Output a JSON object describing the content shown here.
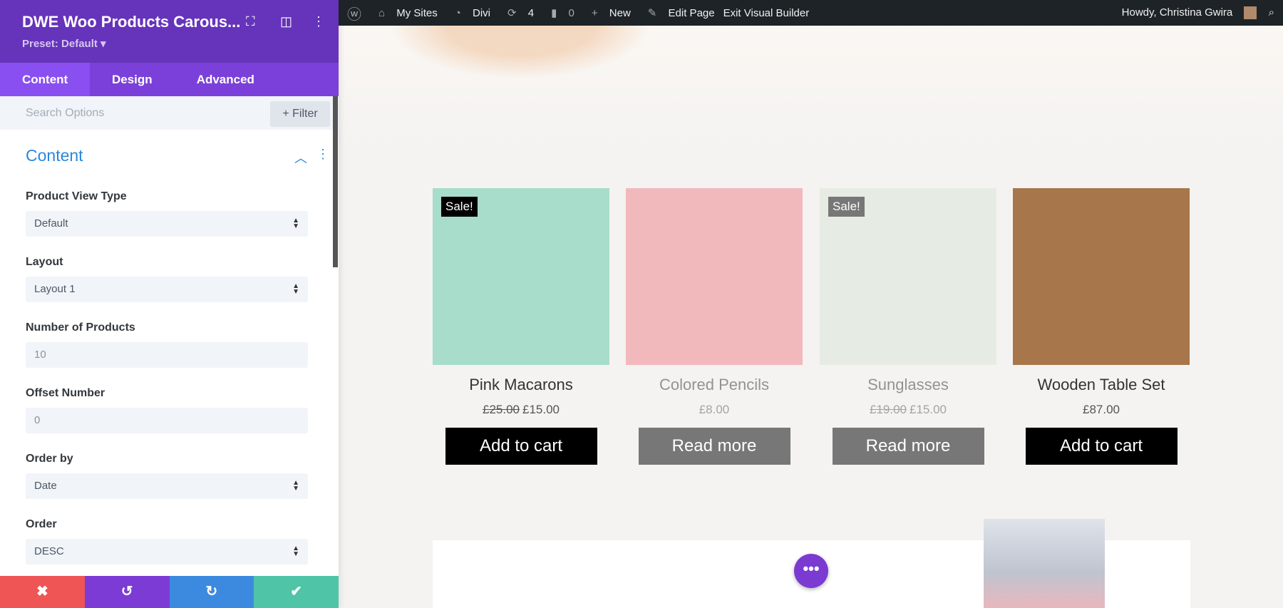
{
  "panel": {
    "title": "DWE Woo Products Carous...",
    "preset": "Preset: Default ▾",
    "tabs": [
      "Content",
      "Design",
      "Advanced"
    ],
    "search_placeholder": "Search Options",
    "filter": "+ Filter",
    "section": "Content",
    "fields": [
      {
        "label": "Product View Type",
        "value": "Default",
        "type": "select"
      },
      {
        "label": "Layout",
        "value": "Layout 1",
        "type": "select"
      },
      {
        "label": "Number of Products",
        "value": "10",
        "type": "input"
      },
      {
        "label": "Offset Number",
        "value": "0",
        "type": "input"
      },
      {
        "label": "Order by",
        "value": "Date",
        "type": "select"
      },
      {
        "label": "Order",
        "value": "DESC",
        "type": "select"
      }
    ],
    "bottom": {
      "close": "✖",
      "undo": "↺",
      "redo": "↻",
      "save": "✔"
    }
  },
  "adminbar": {
    "my_sites": "My Sites",
    "site": "Divi",
    "updates": "4",
    "comments": "0",
    "new": "New",
    "edit": "Edit Page",
    "exit": "Exit Visual Builder",
    "howdy": "Howdy, Christina Gwira"
  },
  "products": [
    {
      "name": "Pink Macarons",
      "old": "£25.00",
      "price": "£15.00",
      "button": "Add to cart",
      "sale": "Sale!",
      "color": "#a8dccb"
    },
    {
      "name": "Colored Pencils",
      "old": "",
      "price": "£8.00",
      "button": "Read more",
      "sale": "",
      "color": "#f2b9bd"
    },
    {
      "name": "Sunglasses",
      "old": "£19.00",
      "price": "£15.00",
      "button": "Read more",
      "sale": "Sale!",
      "color": "#e6ece4"
    },
    {
      "name": "Wooden Table Set",
      "old": "",
      "price": "£87.00",
      "button": "Add to cart",
      "sale": "",
      "color": "#a7764a"
    }
  ],
  "fab": "•••"
}
